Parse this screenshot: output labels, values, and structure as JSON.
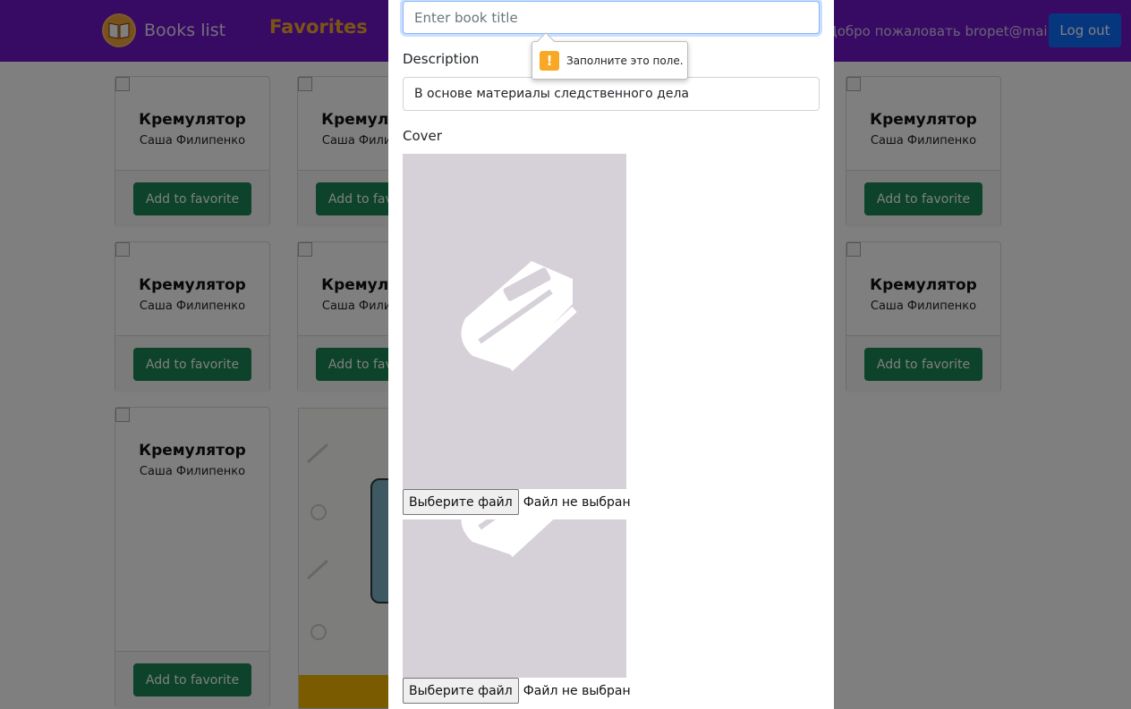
{
  "navbar": {
    "brand_label": "Books list",
    "favorites_label": "Favorites",
    "welcome_text": "Добро пожаловать bropet@mail.ru",
    "logout_label": "Log out"
  },
  "book_cards": [
    {
      "title": "Кремулятор",
      "author": "Саша Филипенко",
      "button": "Add to favorite"
    },
    {
      "title": "Кремулятор",
      "author": "Саша Филипенко",
      "button": "Add to favorite"
    },
    {
      "title": "Кремулятор",
      "author": "Саша Филипенко",
      "button": "Add to favorite"
    },
    {
      "title": "Кремулятор",
      "author": "Саша Филипенко",
      "button": "Add to favorite"
    },
    {
      "title": "Кремулятор",
      "author": "Саша Филипенко",
      "button": "Add to favorite"
    },
    {
      "title": "Кремулятор",
      "author": "Саша Филипенко",
      "button": "Add to favorite"
    },
    {
      "title": "Кремулятор",
      "author": "Саша Филипенко",
      "button": "Add to favorite"
    }
  ],
  "modal": {
    "title_placeholder": "Enter book title",
    "description_label": "Description",
    "description_value": "В основе материалы следственного дела",
    "cover_label": "Cover",
    "file_button_label": "Выберите файл",
    "file_status": "Файл не выбран"
  },
  "validation": {
    "message": "Заполните это поле."
  },
  "colors": {
    "navbar": "#6f16c7",
    "favorites": "#f4a92e",
    "logout": "#0d6efd",
    "favorite_button": "#198754",
    "cover_placeholder": "#d6d1d8",
    "warning": "#f9a825"
  }
}
